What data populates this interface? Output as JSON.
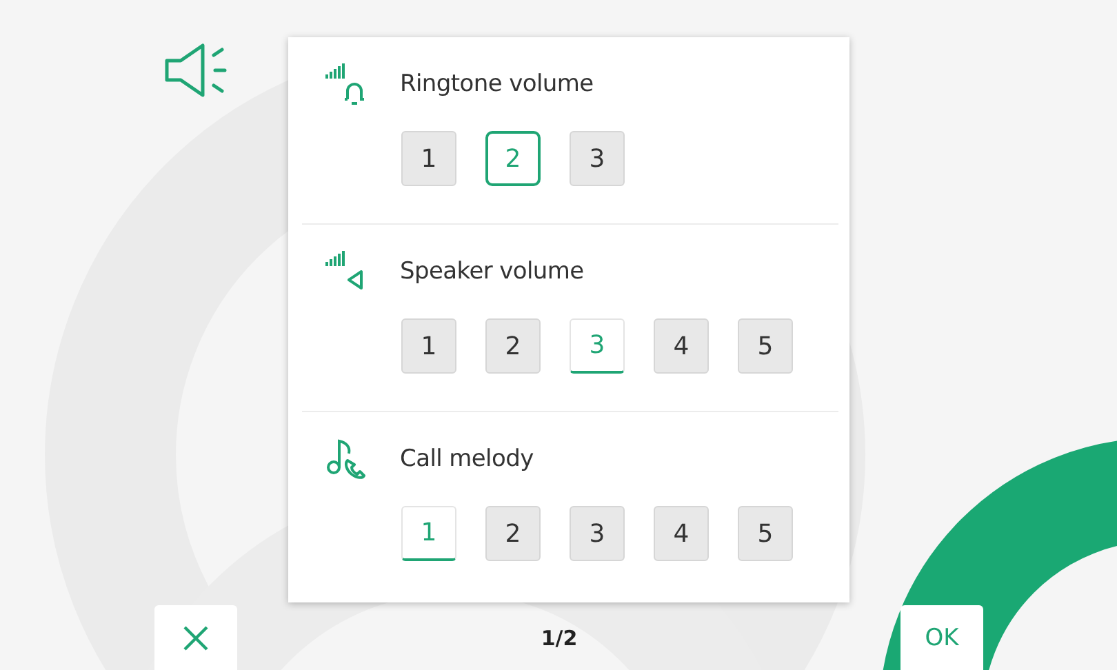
{
  "settings": [
    {
      "kind": "ringtone",
      "label": "Ringtone volume",
      "options": [
        {
          "label": "1",
          "selected": false,
          "focused": false
        },
        {
          "label": "2",
          "selected": true,
          "focused": true
        },
        {
          "label": "3",
          "selected": false,
          "focused": false
        }
      ]
    },
    {
      "kind": "speaker",
      "label": "Speaker volume",
      "options": [
        {
          "label": "1",
          "selected": false,
          "focused": false
        },
        {
          "label": "2",
          "selected": false,
          "focused": false
        },
        {
          "label": "3",
          "selected": true,
          "focused": false
        },
        {
          "label": "4",
          "selected": false,
          "focused": false
        },
        {
          "label": "5",
          "selected": false,
          "focused": false
        }
      ]
    },
    {
      "kind": "melody",
      "label": "Call melody",
      "options": [
        {
          "label": "1",
          "selected": true,
          "focused": false
        },
        {
          "label": "2",
          "selected": false,
          "focused": false
        },
        {
          "label": "3",
          "selected": false,
          "focused": false
        },
        {
          "label": "4",
          "selected": false,
          "focused": false
        },
        {
          "label": "5",
          "selected": false,
          "focused": false
        }
      ]
    }
  ],
  "pager": "1/2",
  "ok_button": {
    "label": "OK"
  }
}
